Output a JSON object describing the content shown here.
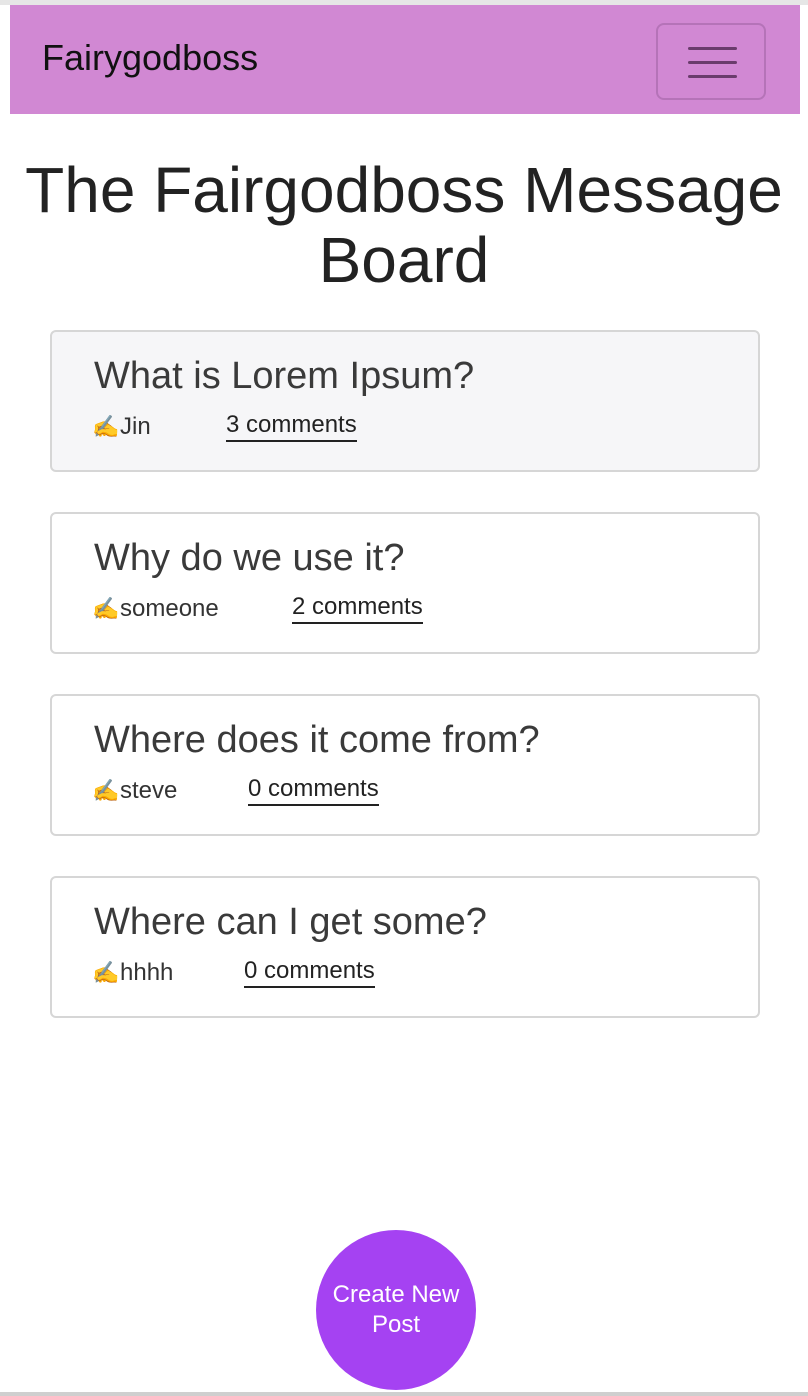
{
  "navbar": {
    "brand": "Fairygodboss",
    "menu_icon": "hamburger-menu-icon",
    "background_color": "#d188d3"
  },
  "page": {
    "title": "The Fairgodboss Message Board"
  },
  "posts": [
    {
      "title": "What is Lorem Ipsum?",
      "author_icon": "writing-hand-icon",
      "author": "Jin",
      "comments": "3 comments"
    },
    {
      "title": "Why do we use it?",
      "author_icon": "writing-hand-icon",
      "author": "someone",
      "comments": "2 comments"
    },
    {
      "title": "Where does it come from?",
      "author_icon": "writing-hand-icon",
      "author": "steve",
      "comments": "0 comments"
    },
    {
      "title": "Where can I get some?",
      "author_icon": "writing-hand-icon",
      "author": "hhhh",
      "comments": "0 comments"
    }
  ],
  "fab": {
    "label": "Create New Post",
    "color": "#a542f2"
  }
}
